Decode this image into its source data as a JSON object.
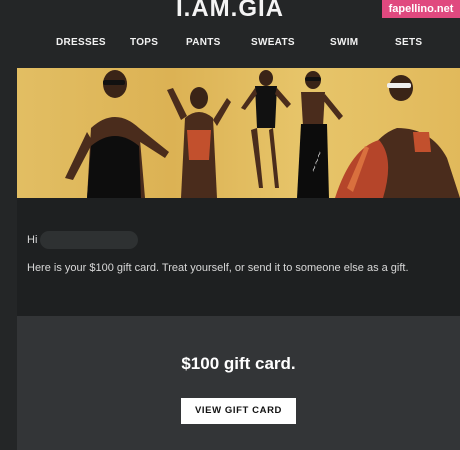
{
  "header": {
    "brand": "I.AM.GIA",
    "watermark": "fapellino.net",
    "nav": [
      "DRESSES",
      "TOPS",
      "PANTS",
      "SWEATS",
      "SWIM",
      "SETS"
    ]
  },
  "email": {
    "greeting": "Hi",
    "message": "Here is your $100 gift card. Treat yourself, or send it to someone else as a gift."
  },
  "gift_card": {
    "title": "$100 gift card.",
    "button_label": "VIEW GIFT CARD"
  },
  "colors": {
    "page_bg": "#242627",
    "content_bg": "#1e2021",
    "gift_panel_bg": "#333537",
    "hero_bg": "#dcb254",
    "watermark_bg": "#e0497f"
  }
}
